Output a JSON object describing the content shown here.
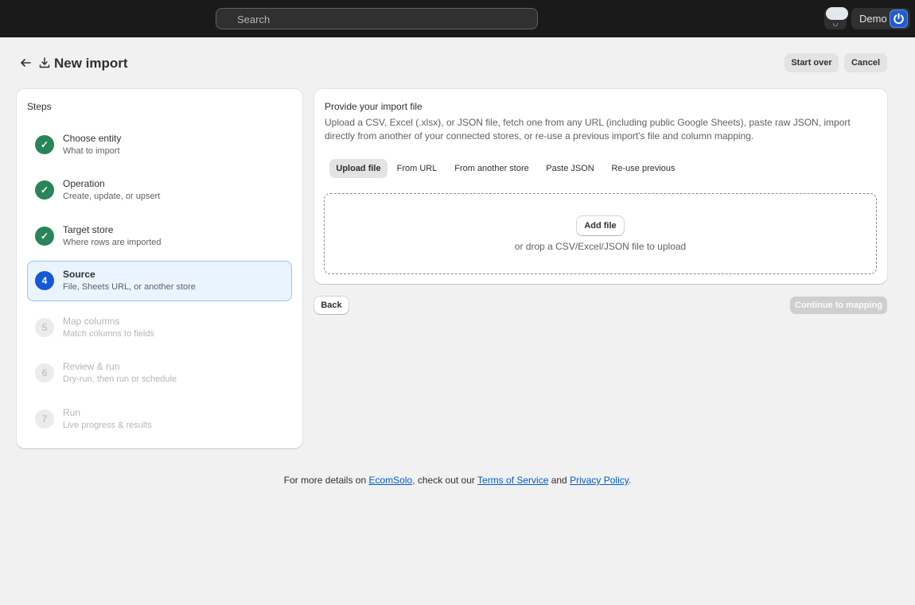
{
  "topbar": {
    "search_placeholder": "Search",
    "account_name": "Demo"
  },
  "header": {
    "title": "New import",
    "start_over_label": "Start over",
    "cancel_label": "Cancel"
  },
  "steps": {
    "heading": "Steps",
    "items": [
      {
        "number": "✓",
        "title": "Choose entity",
        "subtitle": "What to import",
        "state": "done"
      },
      {
        "number": "✓",
        "title": "Operation",
        "subtitle": "Create, update, or upsert",
        "state": "done"
      },
      {
        "number": "✓",
        "title": "Target store",
        "subtitle": "Where rows are imported",
        "state": "done"
      },
      {
        "number": "4",
        "title": "Source",
        "subtitle": "File, Sheets URL, or another store",
        "state": "current"
      },
      {
        "number": "5",
        "title": "Map columns",
        "subtitle": "Match columns to fields",
        "state": "todo"
      },
      {
        "number": "6",
        "title": "Review & run",
        "subtitle": "Dry-run, then run or schedule",
        "state": "todo"
      },
      {
        "number": "7",
        "title": "Run",
        "subtitle": "Live progress & results",
        "state": "todo"
      }
    ]
  },
  "source": {
    "title": "Provide your import file",
    "description": "Upload a CSV, Excel (.xlsx), or JSON file, fetch one from any URL (including public Google Sheets), paste raw JSON, import directly from another of your connected stores, or re-use a previous import's file and column mapping.",
    "tabs": [
      "Upload file",
      "From URL",
      "From another store",
      "Paste JSON",
      "Re-use previous"
    ],
    "selected_tab": "Upload file",
    "add_file_label": "Add file",
    "drop_hint": "or drop a CSV/Excel/JSON file to upload"
  },
  "actions": {
    "back_label": "Back",
    "continue_label": "Continue to mapping"
  },
  "footer": {
    "prefix": "For more details on ",
    "brand_link": "EcomSolo",
    "middle": ", check out our ",
    "terms_link": "Terms of Service",
    "and": " and ",
    "privacy_link": "Privacy Policy",
    "suffix": "."
  }
}
